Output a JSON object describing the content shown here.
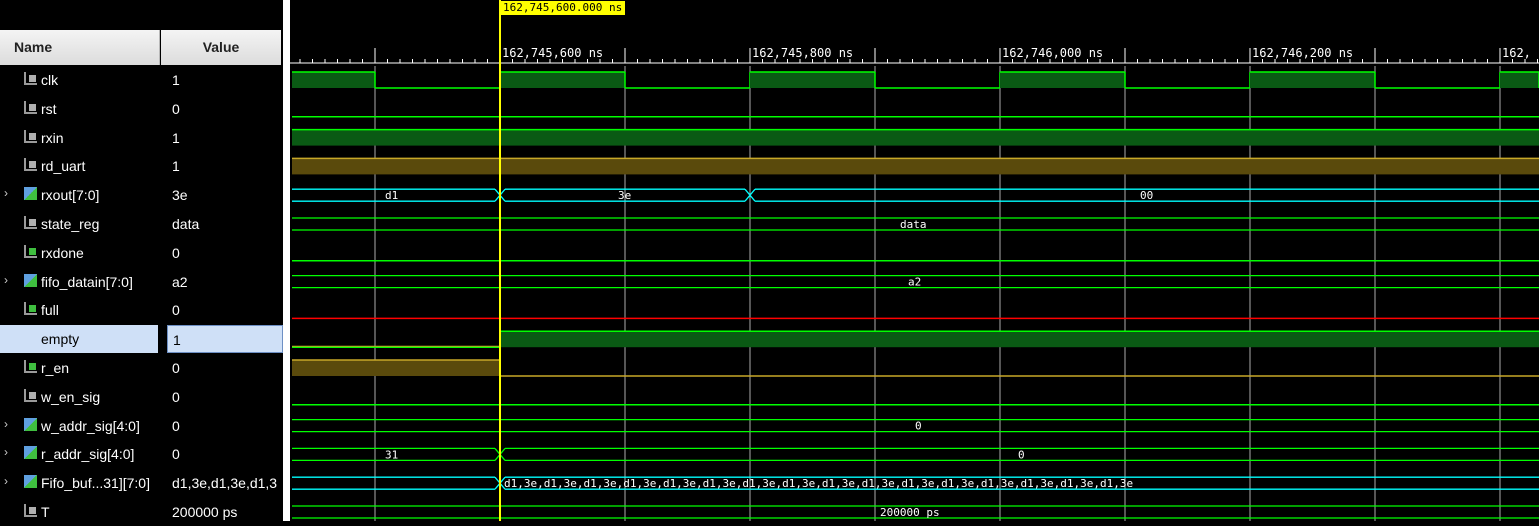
{
  "columns": {
    "name": "Name",
    "value": "Value"
  },
  "cursor": {
    "label": "162,745,600.000 ns"
  },
  "time_ticks": [
    "162,745,600 ns",
    "162,745,800 ns",
    "162,746,000 ns",
    "162,746,200 ns",
    "162,"
  ],
  "signals": [
    {
      "name": "clk",
      "value": "1",
      "icon": "bit-icon",
      "expandable": false
    },
    {
      "name": "rst",
      "value": "0",
      "icon": "bit-icon",
      "expandable": false
    },
    {
      "name": "rxin",
      "value": "1",
      "icon": "bit-icon",
      "expandable": false
    },
    {
      "name": "rd_uart",
      "value": "1",
      "icon": "bit-icon",
      "expandable": false
    },
    {
      "name": "rxout[7:0]",
      "value": "3e",
      "icon": "bus-icon",
      "expandable": true
    },
    {
      "name": "state_reg",
      "value": "data",
      "icon": "bit-icon",
      "expandable": false
    },
    {
      "name": "rxdone",
      "value": "0",
      "icon": "bit-icon",
      "expandable": false
    },
    {
      "name": "fifo_datain[7:0]",
      "value": "a2",
      "icon": "bus-icon",
      "expandable": true
    },
    {
      "name": "full",
      "value": "0",
      "icon": "bit-icon",
      "expandable": false
    },
    {
      "name": "empty",
      "value": "1",
      "icon": "bit-icon",
      "expandable": false,
      "selected": true
    },
    {
      "name": "r_en",
      "value": "0",
      "icon": "bit-icon",
      "expandable": false
    },
    {
      "name": "w_en_sig",
      "value": "0",
      "icon": "bit-icon",
      "expandable": false
    },
    {
      "name": "w_addr_sig[4:0]",
      "value": "0",
      "icon": "bus-icon",
      "expandable": true
    },
    {
      "name": "r_addr_sig[4:0]",
      "value": "0",
      "icon": "bus-icon",
      "expandable": true
    },
    {
      "name": "Fifo_buf...31][7:0]",
      "value": "d1,3e,d1,3e,d1,3",
      "icon": "bus-icon",
      "expandable": true
    },
    {
      "name": "T",
      "value": "200000 ps",
      "icon": "bit-icon",
      "expandable": false
    }
  ],
  "bus_labels": {
    "rxout_before": "d1",
    "rxout_mid": "3e",
    "rxout_after": "00",
    "state_reg": "data",
    "fifo_datain": "a2",
    "w_addr": "0",
    "r_addr_before": "31",
    "r_addr_after": "0",
    "fifo_buf": "d1,3e,d1,3e,d1,3e,d1,3e,d1,3e,d1,3e,d1,3e,d1,3e,d1,3e,d1,3e,d1,3e,d1,3e,d1,3e,d1,3e,d1,3e,d1,3e",
    "T": "200000 ps"
  },
  "colors": {
    "high": "#00ff00",
    "fill": "#0a5a14",
    "bus": "#00ffff",
    "cursor": "#ffff00",
    "xvalue": "#ff0000",
    "yellow": "#c8a828"
  }
}
